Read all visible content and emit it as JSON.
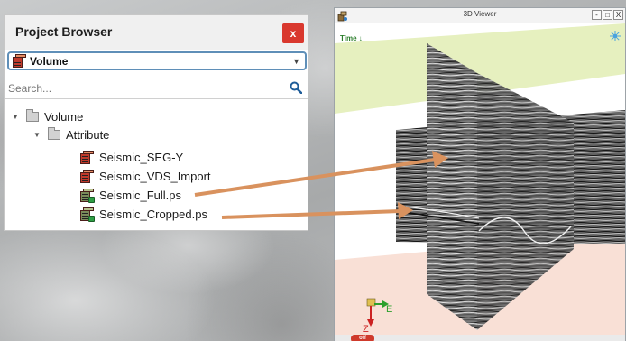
{
  "project_browser": {
    "title": "Project Browser",
    "close_label": "x",
    "selected_type": "Volume",
    "search_placeholder": "Search...",
    "tree": {
      "root": "Volume",
      "group": "Attribute",
      "items": [
        {
          "label": "Seismic_SEG-Y",
          "icon": "seismic-volume-icon"
        },
        {
          "label": "Seismic_VDS_Import",
          "icon": "seismic-volume-icon"
        },
        {
          "label": "Seismic_Full.ps",
          "icon": "prestack-volume-icon"
        },
        {
          "label": "Seismic_Cropped.ps",
          "icon": "prestack-volume-icon"
        }
      ]
    }
  },
  "viewer": {
    "title": "3D Viewer",
    "time_label": "Time",
    "axis_east": "E",
    "axis_z": "Z",
    "mode_badge": "off",
    "buttons": [
      "-",
      "□",
      "X"
    ]
  },
  "colors": {
    "close_red": "#d9382e",
    "select_border": "#5f8fb8",
    "top_plane": "#e6f0bf",
    "bottom_plane": "#f9e0d6",
    "arrow": "#d9925e"
  }
}
